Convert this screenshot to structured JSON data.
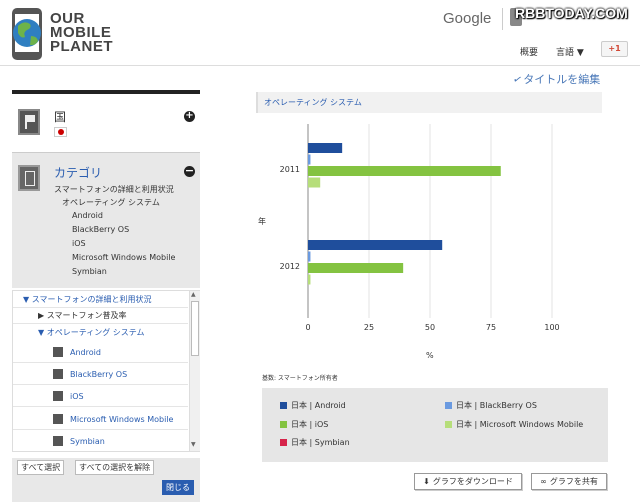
{
  "header": {
    "logo_text": [
      "OUR",
      "MOBILE",
      "PLANET"
    ],
    "google_label": "Google",
    "watermark": "RBBTODAY.COM",
    "nav_overview": "概要",
    "nav_language": "言語 ▼",
    "gplus_label": "+1"
  },
  "edit_title_label": "タイトルを編集",
  "sidebar": {
    "country": {
      "title": "国",
      "expand_symbol": "+"
    },
    "category": {
      "title": "カテゴリ",
      "collapse_symbol": "−",
      "lines": [
        "スマートフォンの詳細と利用状況",
        "オペレーティング システム",
        "Android",
        "BlackBerry OS",
        "iOS",
        "Microsoft Windows Mobile",
        "Symbian"
      ]
    },
    "tree": {
      "root": "▼ スマートフォンの詳細と利用状況",
      "item_penetration": "▶ スマートフォン普及率",
      "item_os": "▼ オペレーティング システム",
      "os_options": [
        "Android",
        "BlackBerry OS",
        "iOS",
        "Microsoft Windows Mobile",
        "Symbian"
      ]
    },
    "buttons": {
      "select_all": "すべて選択",
      "deselect_all": "すべての選択を解除",
      "close": "閉じる"
    }
  },
  "chart_data": {
    "type": "bar",
    "orientation": "horizontal",
    "title": "オペレーティング システム",
    "categories": [
      "2011",
      "2012"
    ],
    "series": [
      {
        "name": "日本 | Android",
        "color": "#1f4e9c",
        "values": [
          14,
          55
        ]
      },
      {
        "name": "日本 | BlackBerry OS",
        "color": "#6a9ae0",
        "values": [
          1,
          1
        ]
      },
      {
        "name": "日本 | iOS",
        "color": "#84c341",
        "values": [
          79,
          39
        ]
      },
      {
        "name": "日本 | Microsoft Windows Mobile",
        "color": "#b6de7a",
        "values": [
          5,
          1
        ]
      },
      {
        "name": "日本 | Symbian",
        "color": "#d6244a",
        "values": [
          0,
          0
        ]
      }
    ],
    "xlabel": "%",
    "ylabel": "年",
    "xticks": [
      0,
      25,
      50,
      75,
      100
    ],
    "xlim": [
      0,
      100
    ],
    "grid": true,
    "legend_position": "bottom",
    "note": "基数: スマートフォン所有者"
  },
  "actions": {
    "download_label": "グラフをダウンロード",
    "share_label": "グラフを共有"
  }
}
